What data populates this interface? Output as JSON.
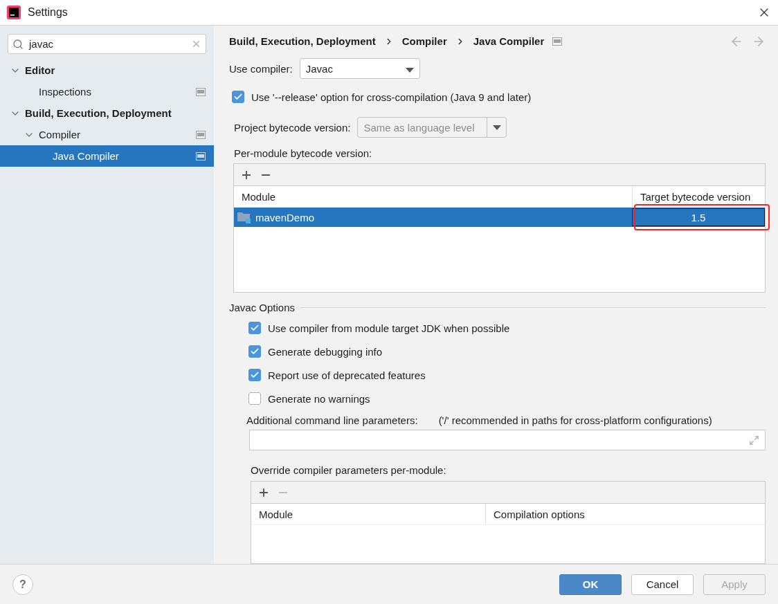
{
  "window": {
    "title": "Settings"
  },
  "sidebar": {
    "search": {
      "value": "javac"
    },
    "tree": [
      {
        "label": "Editor",
        "expanded": true,
        "selected": false,
        "children": [
          {
            "label": "Inspections",
            "selected": false
          }
        ]
      },
      {
        "label": "Build, Execution, Deployment",
        "expanded": true,
        "selected": false,
        "children": [
          {
            "label": "Compiler",
            "expanded": true,
            "selected": false,
            "children": [
              {
                "label": "Java Compiler",
                "selected": true
              }
            ]
          }
        ]
      }
    ]
  },
  "breadcrumb": [
    "Build, Execution, Deployment",
    "Compiler",
    "Java Compiler"
  ],
  "use_compiler": {
    "label": "Use compiler:",
    "value": "Javac"
  },
  "release_option": {
    "label": "Use '--release' option for cross-compilation (Java 9 and later)",
    "checked": true
  },
  "project_bytecode": {
    "label": "Project bytecode version:",
    "placeholder": "Same as language level"
  },
  "per_module": {
    "label": "Per-module bytecode version:",
    "toolbar": [
      {
        "kind": "add",
        "disabled": false
      },
      {
        "kind": "remove",
        "disabled": false
      }
    ],
    "columns": [
      "Module",
      "Target bytecode version"
    ],
    "rows": [
      {
        "module": "mavenDemo",
        "version": "1.5",
        "selected": true,
        "annotated": true
      }
    ]
  },
  "javac_options": {
    "title": "Javac Options",
    "options": [
      {
        "label": "Use compiler from module target JDK when possible",
        "checked": true
      },
      {
        "label": "Generate debugging info",
        "checked": true
      },
      {
        "label": "Report use of deprecated features",
        "checked": true
      },
      {
        "label": "Generate no warnings",
        "checked": false
      }
    ],
    "params_label": "Additional command line parameters:",
    "params_hint": "('/' recommended in paths for cross-platform configurations)"
  },
  "override": {
    "label": "Override compiler parameters per-module:",
    "toolbar": [
      {
        "kind": "add",
        "disabled": false
      },
      {
        "kind": "remove",
        "disabled": true
      }
    ],
    "columns": [
      "Module",
      "Compilation options"
    ]
  },
  "footer": {
    "help": "?",
    "buttons": [
      {
        "label": "OK",
        "kind": "primary",
        "disabled": false
      },
      {
        "label": "Cancel",
        "kind": "default",
        "disabled": false
      },
      {
        "label": "Apply",
        "kind": "default",
        "disabled": true
      }
    ]
  }
}
